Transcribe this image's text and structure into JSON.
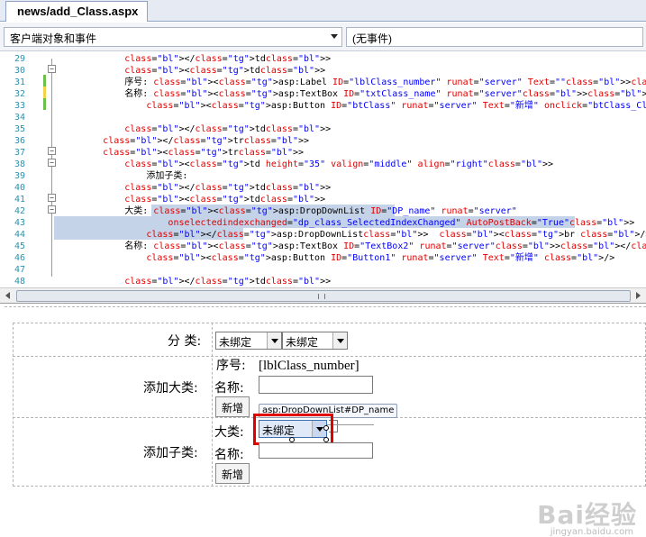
{
  "tab": {
    "title": "news/add_Class.aspx"
  },
  "nav": {
    "object_combo": "客户端对象和事件",
    "event_combo": "(无事件)"
  },
  "editor": {
    "lines": [
      {
        "num": "29",
        "text": "            </td>"
      },
      {
        "num": "30",
        "text": "            <td>"
      },
      {
        "num": "31",
        "text": "            序号: <asp:Label ID=\"lblClass_number\" runat=\"server\" Text=\"\"></asp:Label><br />"
      },
      {
        "num": "32",
        "text": "            名称: <asp:TextBox ID=\"txtClass_name\" runat=\"server\"></asp:TextBox><br />"
      },
      {
        "num": "33",
        "text": "                <asp:Button ID=\"btClass\" runat=\"server\" Text=\"新增\" onclick=\"btClass_Click\" />"
      },
      {
        "num": "34",
        "text": ""
      },
      {
        "num": "35",
        "text": "            </td>"
      },
      {
        "num": "36",
        "text": "        </tr>"
      },
      {
        "num": "37",
        "text": "        <tr>"
      },
      {
        "num": "38",
        "text": "            <td height=\"35\" valign=\"middle\" align=\"right\">"
      },
      {
        "num": "39",
        "text": "                添加子类:"
      },
      {
        "num": "40",
        "text": "            </td>"
      },
      {
        "num": "41",
        "text": "            <td>"
      },
      {
        "num": "42",
        "text": "            大类: <asp:DropDownList ID=\"DP_name\" runat=\"server\""
      },
      {
        "num": "43",
        "text": "                    onselectedindexchanged=\"dp_class_SelectedIndexChanged\" AutoPostBack=\"True\">"
      },
      {
        "num": "44",
        "text": "                </asp:DropDownList>  <br />"
      },
      {
        "num": "45",
        "text": "            名称: <asp:TextBox ID=\"TextBox2\" runat=\"server\"></asp:TextBox><br />"
      },
      {
        "num": "46",
        "text": "                <asp:Button ID=\"Button1\" runat=\"server\" Text=\"新增\" />"
      },
      {
        "num": "47",
        "text": ""
      },
      {
        "num": "48",
        "text": "            </td>"
      }
    ]
  },
  "design": {
    "row1": {
      "label": "分 类:",
      "ddl1": "未绑定",
      "ddl2": "未绑定"
    },
    "row2": {
      "label": "添加大类:",
      "seq_label": "序号:",
      "seq_value": "[lblClass_number]",
      "name_label": "名称:",
      "button": "新增"
    },
    "tooltip": "asp:DropDownList#DP_name",
    "row3": {
      "label": "添加子类:",
      "big_label": "大类:",
      "ddl": "未绑定",
      "name_label": "名称:",
      "button": "新增"
    }
  },
  "watermark": {
    "brand": "Bai经验",
    "url": "jingyan.baidu.com"
  },
  "colors": {
    "highlight_box": "#e00000",
    "selection": "#c5d3e8"
  }
}
